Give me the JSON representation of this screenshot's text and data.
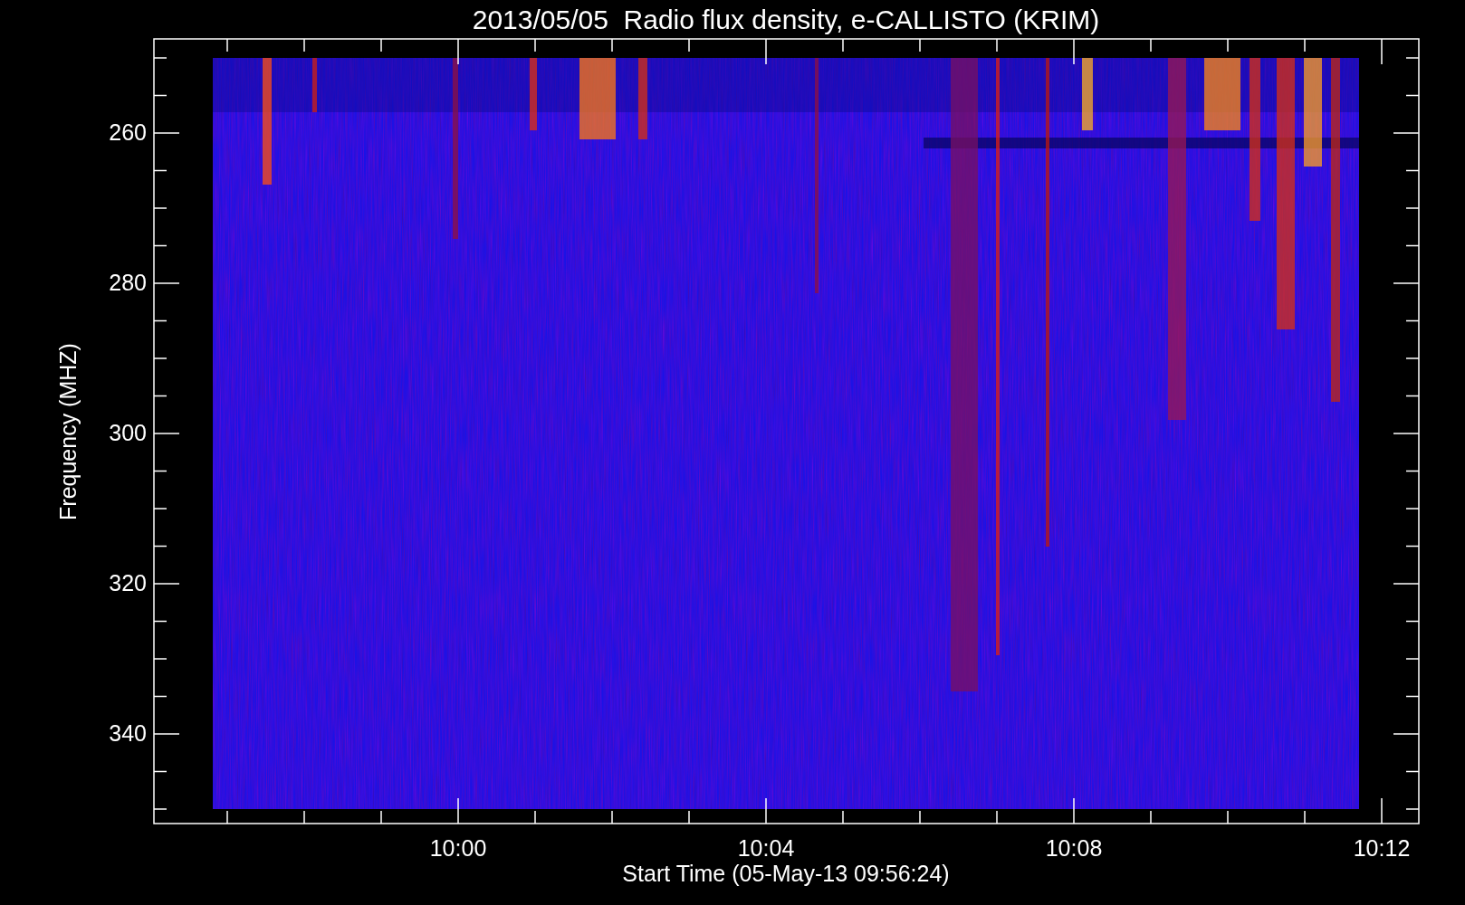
{
  "title": "2013/05/05  Radio flux density, e-CALLISTO (KRIM)",
  "y_axis": {
    "label": "Frequency (MHZ)",
    "ticks": [
      "260",
      "280",
      "300",
      "320",
      "340"
    ]
  },
  "x_axis": {
    "label": "Start Time (05-May-13 09:56:24)",
    "ticks": [
      "10:00",
      "10:04",
      "10:08",
      "10:12"
    ]
  }
}
